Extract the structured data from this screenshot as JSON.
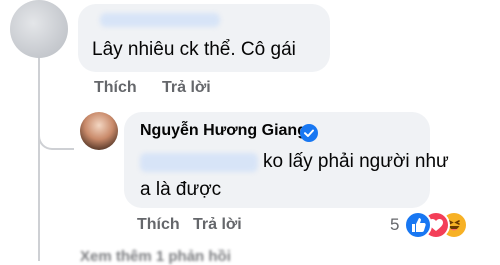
{
  "comment_1": {
    "text": "Lây nhiêu ck thể. Cô gái",
    "actions": {
      "like": "Thích",
      "reply": "Trả lời"
    }
  },
  "comment_2": {
    "author": "Nguyễn Hương Giang",
    "text_line_1": "ko lấy phải người như",
    "text_line_2": "a là được",
    "actions": {
      "like": "Thích",
      "reply": "Trả lời"
    },
    "reaction_count": "5",
    "reactions": [
      "like-icon",
      "love-icon",
      "haha-icon"
    ]
  },
  "footer": {
    "view_more": "Xem thêm 1 phản hồi"
  },
  "colors": {
    "bubble": "#f0f2f5",
    "verified": "#1877f2",
    "action_text": "#65676b"
  }
}
